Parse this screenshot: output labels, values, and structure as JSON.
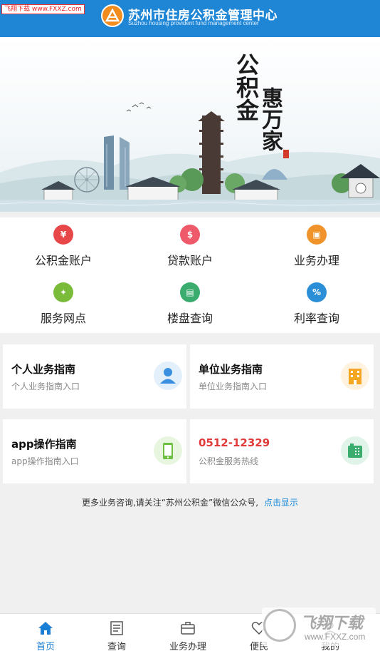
{
  "watermark_top": "飞翔下载 www.FXXZ.com",
  "header": {
    "title": "苏州市住房公积金管理中心",
    "subtitle": "Suzhou housing provident fund management center"
  },
  "banner": {
    "calligraphy": [
      "公积金",
      "惠万家"
    ]
  },
  "menu": [
    {
      "label": "公积金账户",
      "icon": "yen-account-icon",
      "color": "#e8474a"
    },
    {
      "label": "贷款账户",
      "icon": "loan-bag-icon",
      "color": "#ee5a6a"
    },
    {
      "label": "业务办理",
      "icon": "briefcase-icon",
      "color": "#f0932b"
    },
    {
      "label": "服务网点",
      "icon": "map-point-icon",
      "color": "#7bbb3a"
    },
    {
      "label": "楼盘查询",
      "icon": "building-icon",
      "color": "#3aac6e"
    },
    {
      "label": "利率查询",
      "icon": "percent-icon",
      "color": "#2b8fd8"
    }
  ],
  "cards": [
    {
      "title": "个人业务指南",
      "sub": "个人业务指南入口",
      "icon": "person-icon"
    },
    {
      "title": "单位业务指南",
      "sub": "单位业务指南入口",
      "icon": "office-building-icon"
    },
    {
      "title": "app操作指南",
      "sub": "app操作指南入口",
      "icon": "mobile-phone-icon"
    },
    {
      "title": "0512-12329",
      "sub": "公积金服务热线",
      "icon": "telephone-icon",
      "title_color": "#e03a3a"
    }
  ],
  "notice": {
    "text": "更多业务咨询,请关注“苏州公积金”微信公众号,",
    "link": "点击显示"
  },
  "tabs": [
    {
      "label": "首页",
      "icon": "home-icon",
      "active": true
    },
    {
      "label": "查询",
      "icon": "document-icon",
      "active": false
    },
    {
      "label": "业务办理",
      "icon": "briefcase-icon",
      "active": false
    },
    {
      "label": "便民",
      "icon": "heart-icon",
      "active": false
    },
    {
      "label": "我的",
      "icon": "user-icon",
      "active": false
    }
  ],
  "watermark_bottom": {
    "title": "飞翔下载",
    "url": "www.FXXZ.com"
  },
  "colors": {
    "header": "#1f86d6",
    "accent": "#1a7fd4",
    "hotline": "#e03a3a"
  }
}
